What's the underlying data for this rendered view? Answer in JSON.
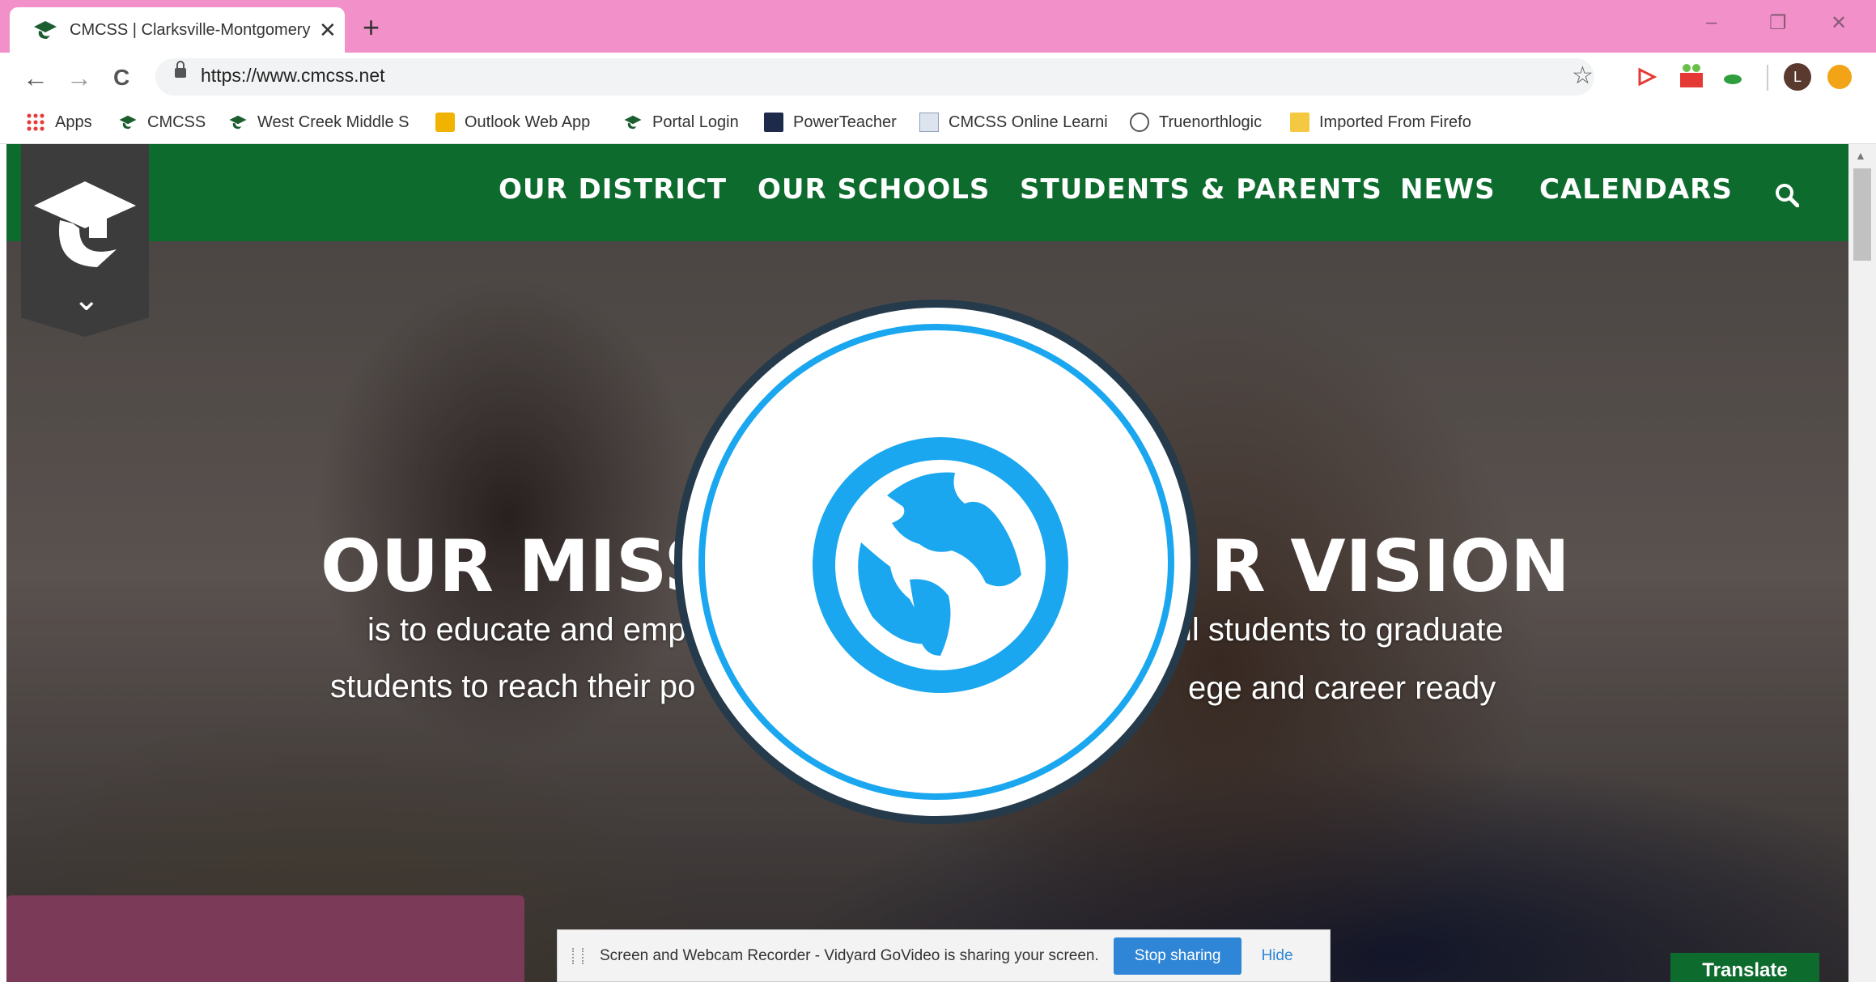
{
  "browser": {
    "tab_title": "CMCSS | Clarksville-Montgomery",
    "tab_close": "✕",
    "new_tab": "+",
    "window_buttons": {
      "minimize": "–",
      "restore": "❐",
      "close": "✕"
    },
    "nav": {
      "back": "←",
      "forward": "→",
      "reload": "C"
    },
    "url": "https://www.cmcss.net",
    "star": "☆",
    "profile_initial": "L",
    "bookmarks": [
      {
        "label": "Apps",
        "icon": "apps-grid-icon"
      },
      {
        "label": "CMCSS",
        "icon": "cmcss-favicon-icon"
      },
      {
        "label": "West Creek Middle S",
        "icon": "cmcss-favicon-icon"
      },
      {
        "label": "Outlook Web App",
        "icon": "outlook-icon"
      },
      {
        "label": "Portal Login",
        "icon": "cmcss-favicon-icon"
      },
      {
        "label": "PowerTeacher",
        "icon": "powerteacher-icon"
      },
      {
        "label": "CMCSS Online Learni",
        "icon": "document-icon"
      },
      {
        "label": "Truenorthlogic",
        "icon": "truenorthlogic-icon"
      },
      {
        "label": "Imported From Firefo",
        "icon": "folder-icon"
      }
    ]
  },
  "site": {
    "nav": [
      "OUR DISTRICT",
      "OUR SCHOOLS",
      "STUDENTS & PARENTS",
      "NEWS",
      "CALENDARS"
    ],
    "chevron": "⌄",
    "mission_title": "OUR MISS",
    "vision_title": "R VISION",
    "mission_line1": "is to educate and emp",
    "mission_line2": "students to reach their po",
    "vision_line1": "ll students to graduate",
    "vision_line2": "ege and career ready",
    "translate": "Translate"
  },
  "sharebar": {
    "message": "Screen and Webcam Recorder - Vidyard GoVideo is sharing your screen.",
    "stop": "Stop sharing",
    "hide": "Hide"
  },
  "colors": {
    "titlebar": "#f291c9",
    "site_green": "#0e6b2e",
    "badge_blue": "#1aa7ef",
    "badge_border": "#253a4a",
    "share_button": "#2f86d6"
  }
}
